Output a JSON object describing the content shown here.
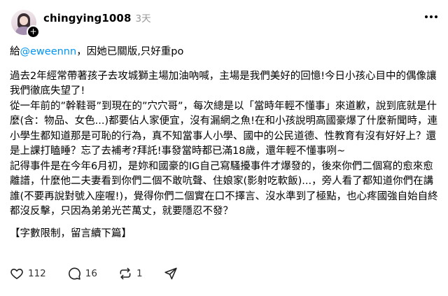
{
  "post": {
    "username": "chingying1008",
    "time": "3天",
    "reply_prefix": "給",
    "mention": "@eweennn",
    "reply_suffix": "，因她已關版,只好重po",
    "paragraphs": [
      "過去2年經常帶著孩子去攻城獅主場加油吶喊，主場是我們美好的回憶!今日小孩心目中的偶像讓我們徹底失望了!",
      "從一年前的”幹鞋哥”到現在的”穴穴哥”，每次總是以「當時年輕不懂事」來道歉，說到底就是什麼(含：物品、女色...)都要佔人家便宜，沒有漏網之魚!在和小孩說明高國豪爆了什麼新聞時，連小學生都知道那是可恥的行為，真不知當事人小學、國中的公民道德、性教育有沒有好好上？還是上課打瞌睡？忘了去補考?拜託!事發當時都已滿18歲，還年輕不懂事咧~",
      "記得事件是在今年6月初，是妳和國豪的IG自己寫騷擾事件才爆發的，後來你們二個寫的愈來愈離譜，什麼他二夫妻看到你們二個不敢吭聲、住娘家(影射吃軟飯)...，旁人看了都知道你們在講誰(不要再說對號入座喔!)，覺得你們二個實在口不擇言、沒水準到了極點，也心疼國強自始自終都沒反擊，只因為弟弟光芒萬丈，就要隱忍不發？"
    ],
    "footer_note": "【字數限制，留言續下篇】"
  },
  "actions": {
    "likes": "112",
    "comments": "16",
    "reposts": "1"
  },
  "icons": [
    "avatar",
    "plus-icon",
    "more-icon",
    "heart-icon",
    "comment-icon",
    "repost-icon",
    "share-icon"
  ],
  "colors": {
    "mention": "#0095f6",
    "muted": "#999999",
    "text": "#000000"
  }
}
